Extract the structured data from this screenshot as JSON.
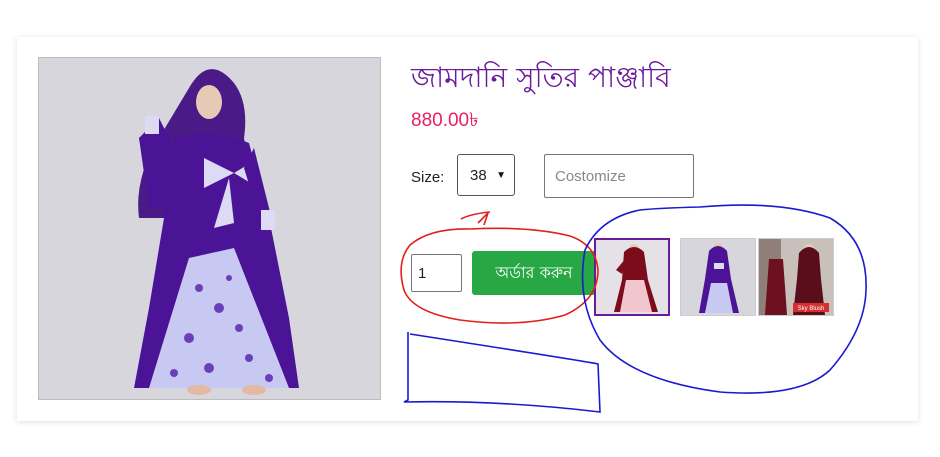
{
  "product": {
    "title": "জামদানি সুতির পাঞ্জাবি",
    "price": "880.00৳"
  },
  "size": {
    "label": "Size:",
    "selected": "38"
  },
  "customize": {
    "placeholder": "Costomize"
  },
  "quantity": {
    "value": "1"
  },
  "order_button": {
    "label": "অর্ডার করুন"
  },
  "thumbnails": [
    {
      "icon": "thumbnail-maroon-dress"
    },
    {
      "icon": "thumbnail-purple-dress"
    },
    {
      "icon": "thumbnail-maroon-model",
      "badge": "Sky Blush"
    }
  ],
  "colors": {
    "title": "#6a1b9a",
    "price": "#e91e63",
    "button": "#28a745",
    "annotation_red": "#e0201a",
    "annotation_blue": "#1a1ad0"
  }
}
